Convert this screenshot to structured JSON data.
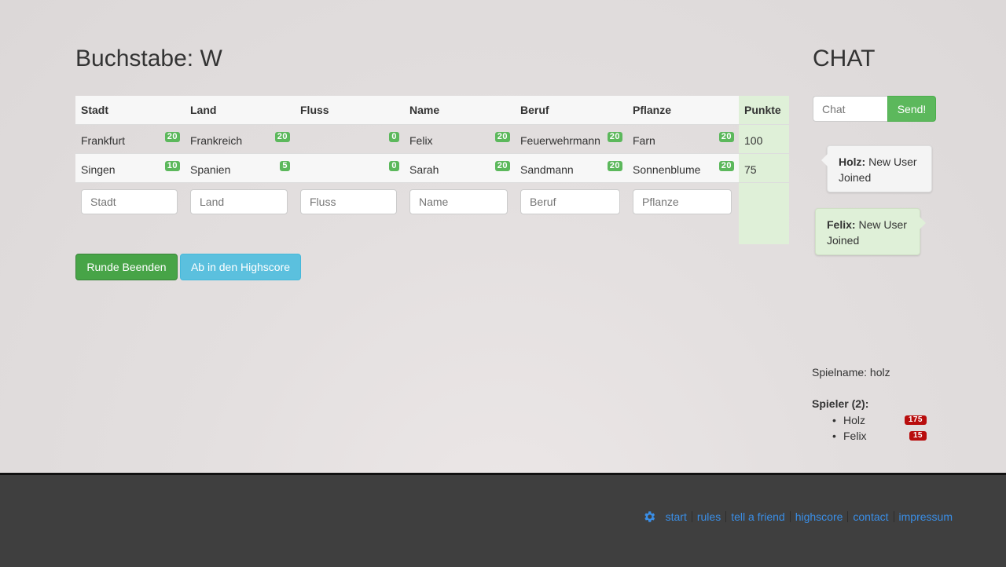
{
  "game": {
    "letter_title": "Buchstabe: W",
    "headers": [
      "Stadt",
      "Land",
      "Fluss",
      "Name",
      "Beruf",
      "Pflanze",
      "Punkte"
    ],
    "rows": [
      {
        "cells": [
          {
            "text": "Frankfurt",
            "score": "20"
          },
          {
            "text": "Frankreich",
            "score": "20"
          },
          {
            "text": "",
            "score": "0"
          },
          {
            "text": "Felix",
            "score": "20"
          },
          {
            "text": "Feuerwehrmann",
            "score": "20"
          },
          {
            "text": "Farn",
            "score": "20"
          }
        ],
        "points": "100"
      },
      {
        "cells": [
          {
            "text": "Singen",
            "score": "10"
          },
          {
            "text": "Spanien",
            "score": "5"
          },
          {
            "text": "",
            "score": "0"
          },
          {
            "text": "Sarah",
            "score": "20"
          },
          {
            "text": "Sandmann",
            "score": "20"
          },
          {
            "text": "Sonnenblume",
            "score": "20"
          }
        ],
        "points": "75"
      }
    ],
    "placeholders": [
      "Stadt",
      "Land",
      "Fluss",
      "Name",
      "Beruf",
      "Pflanze"
    ],
    "buttons": {
      "end_round": "Runde Beenden",
      "highscore": "Ab in den Highscore"
    }
  },
  "chat": {
    "title": "CHAT",
    "placeholder": "Chat",
    "send_label": "Send!",
    "messages": [
      {
        "user": "Holz:",
        "text": "New User Joined"
      },
      {
        "user": "Felix:",
        "text": "New User Joined"
      }
    ]
  },
  "info": {
    "game_name": "Spielname: holz",
    "players_label": "Spieler (2):",
    "players": [
      {
        "name": "Holz",
        "score": "175"
      },
      {
        "name": "Felix",
        "score": "15"
      }
    ]
  },
  "footer": {
    "icon": "gear-icon",
    "links": [
      "start",
      "rules",
      "tell a friend",
      "highscore",
      "contact",
      "impressum"
    ]
  },
  "colors": {
    "success": "#5cb85c",
    "info": "#5bc0de",
    "danger": "#b80d0d",
    "link": "#3a8ee6",
    "footer_bg": "#3f3f3f"
  }
}
